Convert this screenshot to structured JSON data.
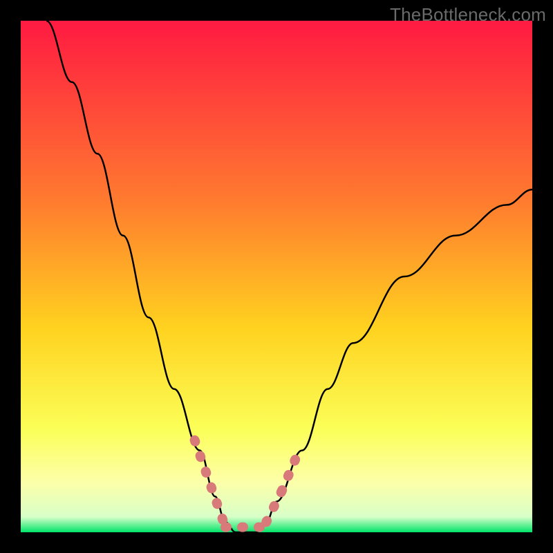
{
  "watermark": "TheBottleneck.com",
  "colors": {
    "frame": "#000000",
    "grad_top": "#ff1a42",
    "grad_mid_upper": "#ff7a2f",
    "grad_mid": "#ffd21f",
    "grad_low": "#fbff58",
    "grad_pale": "#fdffa8",
    "grad_green": "#00e46a",
    "curve": "#000000",
    "marker": "#d87a7a"
  },
  "chart_data": {
    "type": "line",
    "title": "",
    "xlabel": "",
    "ylabel": "",
    "xlim": [
      0,
      100
    ],
    "ylim": [
      0,
      100
    ],
    "grid": false,
    "legend": false,
    "series": [
      {
        "name": "bottleneck_curve",
        "x": [
          5,
          10,
          15,
          20,
          25,
          30,
          35,
          38,
          40,
          42,
          44,
          46,
          48,
          50,
          55,
          60,
          65,
          75,
          85,
          95,
          100
        ],
        "y": [
          100,
          88,
          74,
          58,
          42,
          28,
          16,
          7,
          2,
          0,
          0,
          0,
          2,
          6,
          16,
          28,
          37,
          50,
          58,
          64,
          67
        ]
      }
    ],
    "highlight_segments": [
      {
        "x": [
          34,
          40
        ],
        "y": [
          18,
          1
        ]
      },
      {
        "x": [
          40,
          48
        ],
        "y": [
          1,
          1
        ]
      },
      {
        "x": [
          48,
          51
        ],
        "y": [
          2,
          8
        ]
      },
      {
        "x": [
          51,
          54
        ],
        "y": [
          8,
          15
        ]
      }
    ],
    "gradient_stops": [
      {
        "pct": 0,
        "color": "#ff1a42"
      },
      {
        "pct": 35,
        "color": "#ff7a2f"
      },
      {
        "pct": 60,
        "color": "#ffd21f"
      },
      {
        "pct": 80,
        "color": "#fbff58"
      },
      {
        "pct": 90,
        "color": "#fdffa8"
      },
      {
        "pct": 97,
        "color": "#d8ffc8"
      },
      {
        "pct": 100,
        "color": "#00e46a"
      }
    ]
  }
}
